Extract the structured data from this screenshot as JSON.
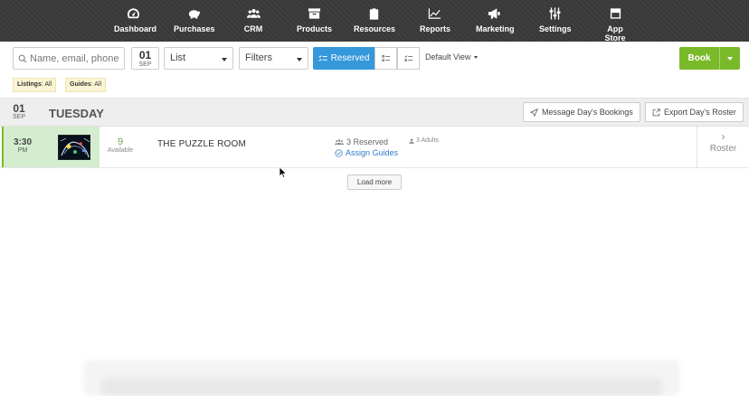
{
  "nav": {
    "items": [
      {
        "label": "Dashboard",
        "icon": "dashboard-icon"
      },
      {
        "label": "Purchases",
        "icon": "piggy-bank-icon"
      },
      {
        "label": "CRM",
        "icon": "users-icon"
      },
      {
        "label": "Products",
        "icon": "box-icon"
      },
      {
        "label": "Resources",
        "icon": "clipboard-icon"
      },
      {
        "label": "Reports",
        "icon": "chart-line-icon"
      },
      {
        "label": "Marketing",
        "icon": "megaphone-icon"
      },
      {
        "label": "Settings",
        "icon": "sliders-icon"
      },
      {
        "label": "App Store",
        "icon": "window-icon"
      }
    ]
  },
  "toolbar": {
    "search_placeholder": "Name, email, phone",
    "date_day": "01",
    "date_month": "SEP",
    "view_select": "List",
    "filters_select": "Filters",
    "reserved_label": "Reserved",
    "default_view": "Default View",
    "book_label": "Book"
  },
  "chips": [
    {
      "label": "Listings",
      "value": ": All"
    },
    {
      "label": "Guides",
      "value": ": All"
    }
  ],
  "day": {
    "day_num": "01",
    "month": "SEP",
    "weekday": "TUESDAY",
    "message_btn": "Message Day's Bookings",
    "export_btn": "Export Day's Roster"
  },
  "booking": {
    "time": "3:30",
    "ampm": "PM",
    "available_count": "9",
    "available_label": "Available",
    "title": "THE PUZZLE ROOM",
    "reserved": "3 Reserved",
    "assign_guides": "Assign Guides",
    "adults": "3 Adults",
    "roster_label": "Roster"
  },
  "load_more": "Load more",
  "colors": {
    "nav_bg": "#3a3a3a",
    "accent_blue": "#3498db",
    "book_green": "#7ab929",
    "row_highlight": "#d3edce",
    "chip_bg": "#fbf5d4",
    "link_blue": "#2f7cc9"
  }
}
